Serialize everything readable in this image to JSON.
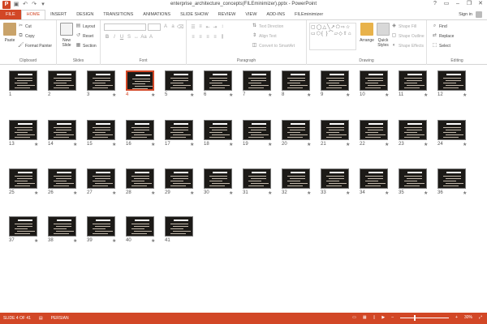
{
  "app": {
    "logo": "P",
    "title": "enterprise_architecture_concepts(FILEminimizer).pptx - PowerPoint",
    "signin": "Sign in"
  },
  "icons": {
    "save": "save-icon",
    "undo": "undo-icon",
    "redo": "redo-icon",
    "help": "help-icon",
    "minimize": "minimize-icon",
    "restore": "restore-icon",
    "close": "close-icon"
  },
  "tabs": [
    "FILE",
    "HOME",
    "INSERT",
    "DESIGN",
    "TRANSITIONS",
    "ANIMATIONS",
    "SLIDE SHOW",
    "REVIEW",
    "VIEW",
    "ADD-INS",
    "FILEminimizer"
  ],
  "active_tab": "HOME",
  "ribbon": {
    "clipboard": {
      "label": "Clipboard",
      "paste": "Paste",
      "cut": "Cut",
      "copy": "Copy",
      "format_painter": "Format Painter"
    },
    "slides": {
      "label": "Slides",
      "new_slide": "New Slide",
      "layout": "Layout",
      "reset": "Reset",
      "section": "Section"
    },
    "font": {
      "label": "Font"
    },
    "paragraph": {
      "label": "Paragraph",
      "text_direction": "Text Direction",
      "align_text": "Align Text",
      "convert_smartart": "Convert to SmartArt"
    },
    "drawing": {
      "label": "Drawing",
      "arrange": "Arrange",
      "quick_styles": "Quick Styles",
      "shape_fill": "Shape Fill",
      "shape_outline": "Shape Outline",
      "shape_effects": "Shape Effects"
    },
    "editing": {
      "label": "Editing",
      "find": "Find",
      "replace": "Replace",
      "select": "Select"
    }
  },
  "slides": {
    "selected": 4,
    "numbers": [
      "1",
      "2",
      "3",
      "4",
      "5",
      "6",
      "7",
      "8",
      "9",
      "10",
      "11",
      "12",
      "13",
      "14",
      "15",
      "16",
      "17",
      "18",
      "19",
      "20",
      "21",
      "22",
      "23",
      "24",
      "25",
      "26",
      "27",
      "28",
      "29",
      "30",
      "31",
      "32",
      "33",
      "34",
      "35",
      "36",
      "37",
      "38",
      "39",
      "40",
      "41"
    ],
    "star_glyph": "★"
  },
  "status": {
    "slide_info": "SLIDE 4 OF 41",
    "language": "PERSIAN",
    "zoom": "30%",
    "zoom_fraction": 0.3
  }
}
